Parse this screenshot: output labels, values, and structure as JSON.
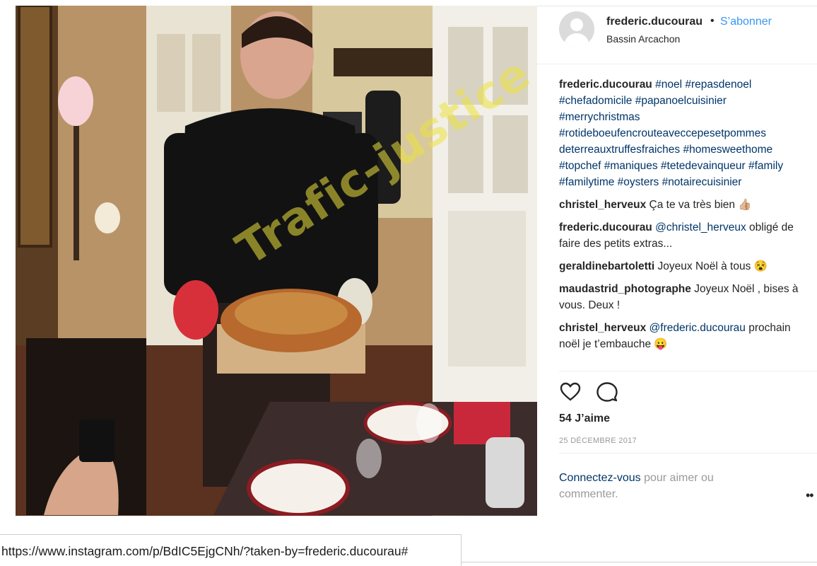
{
  "photo": {
    "alt": "Post photo",
    "watermark": "Trafic-justice"
  },
  "header": {
    "username": "frederic.ducourau",
    "separator": "•",
    "follow_label": "S’abonner",
    "location": "Bassin Arcachon"
  },
  "caption": {
    "user": "frederic.ducourau",
    "hashtags": "#noel #repasdenoel #chefadomicile #papanoelcuisinier #merrychristmas #rotideboeufencrouteaveccepesetpommes deterreauxtruffesfraiches #homesweethome #topchef #maniques #tetedevainqueur #family #familytime #oysters #notairecuisinier"
  },
  "comments": [
    {
      "user": "christel_herveux",
      "text": "Ça te va très bien 👍🏼"
    },
    {
      "user": "frederic.ducourau",
      "mention": "@christel_herveux",
      "text": " obligé de faire des petits extras..."
    },
    {
      "user": "geraldinebartoletti",
      "text": "Joyeux Noël à tous 😵"
    },
    {
      "user": "maudastrid_photographe",
      "text": "Joyeux Noël , bises à vous. Deux !"
    },
    {
      "user": "christel_herveux",
      "mention": "@frederic.ducourau",
      "text": " prochain noël je t’embauche 😛"
    }
  ],
  "actions": {
    "like_icon": "heart-icon",
    "comment_icon": "comment-bubble-icon"
  },
  "likes_label": "54 J’aime",
  "date": "25 DÉCEMBRE 2017",
  "login": {
    "link": "Connectez-vous",
    "text": " pour aimer ou commenter."
  },
  "more_label": "••",
  "status_url": "https://www.instagram.com/p/BdIC5EjgCNh/?taken-by=frederic.ducourau#",
  "colors": {
    "link_blue": "#3897f0",
    "hashtag": "#003569",
    "muted": "#999999"
  }
}
